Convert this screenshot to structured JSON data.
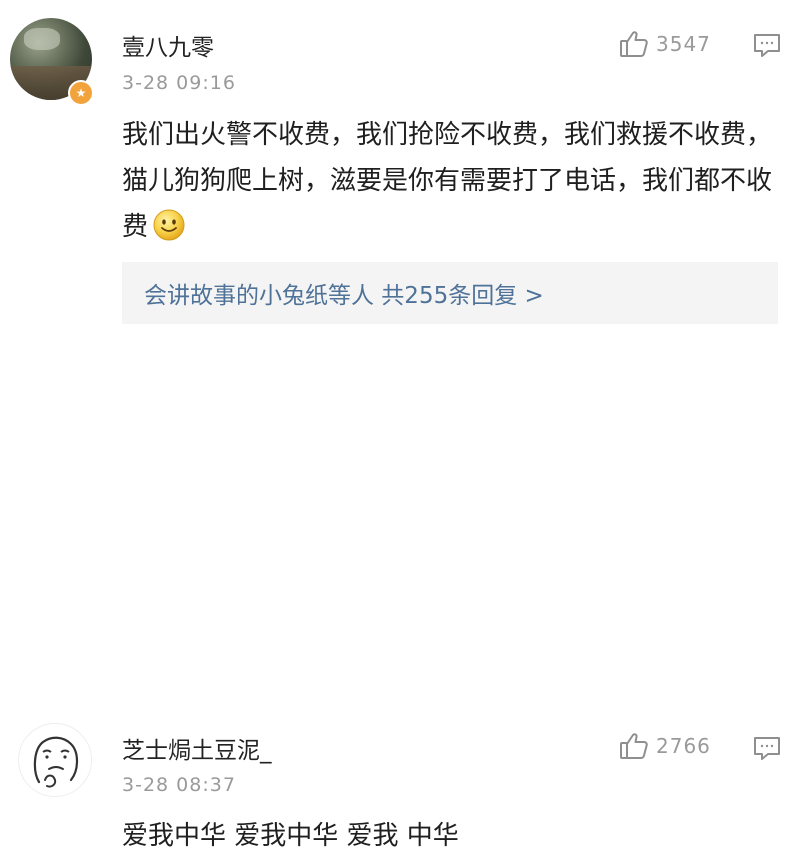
{
  "comments": [
    {
      "username": "壹八九零",
      "timestamp": "3-28 09:16",
      "likes": "3547",
      "text": "我们出火警不收费，我们抢险不收费，我们救援不收费，猫儿狗狗爬上树，滋要是你有需要打了电话，我们都不收费",
      "replies_summary": "会讲故事的小兔纸等人  共255条回复 >",
      "verified_badge": "★"
    },
    {
      "username": "芝士焗土豆泥_",
      "timestamp": "3-28 08:37",
      "likes": "2766",
      "text": "爱我中华 爱我中华 爱我 中华"
    }
  ],
  "icons": {
    "like": "thumbs-up-outline",
    "reply": "comment-bubble",
    "emoji": "smiley-face"
  },
  "colors": {
    "link_blue": "#4f7298",
    "meta_gray": "#9a9a9a",
    "badge_orange": "#f2a33c",
    "replies_bg": "#f4f4f4"
  }
}
